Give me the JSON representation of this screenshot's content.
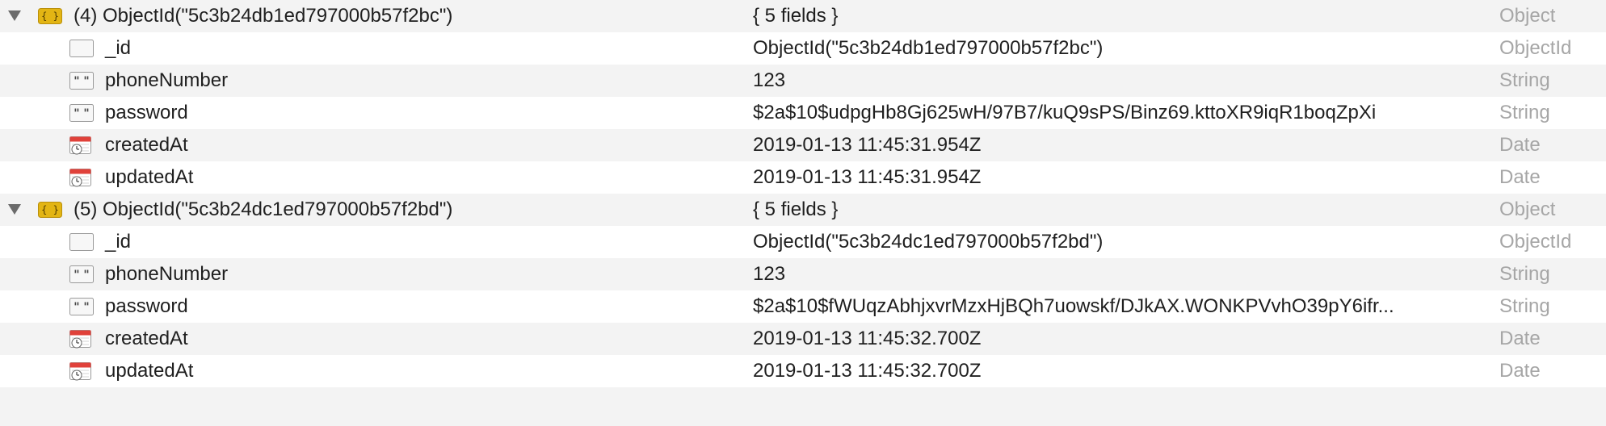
{
  "documents": [
    {
      "label": "(4) ObjectId(\"5c3b24db1ed797000b57f2bc\")",
      "summary": "{ 5 fields }",
      "type": "Object",
      "fields": [
        {
          "name": "_id",
          "value": "ObjectId(\"5c3b24db1ed797000b57f2bc\")",
          "type": "ObjectId",
          "icon": "objectid-icon"
        },
        {
          "name": "phoneNumber",
          "value": "123",
          "type": "String",
          "icon": "string-icon"
        },
        {
          "name": "password",
          "value": "$2a$10$udpgHb8Gj625wH/97B7/kuQ9sPS/Binz69.kttoXR9iqR1boqZpXi",
          "type": "String",
          "icon": "string-icon"
        },
        {
          "name": "createdAt",
          "value": "2019-01-13 11:45:31.954Z",
          "type": "Date",
          "icon": "date-icon"
        },
        {
          "name": "updatedAt",
          "value": "2019-01-13 11:45:31.954Z",
          "type": "Date",
          "icon": "date-icon"
        }
      ]
    },
    {
      "label": "(5) ObjectId(\"5c3b24dc1ed797000b57f2bd\")",
      "summary": "{ 5 fields }",
      "type": "Object",
      "fields": [
        {
          "name": "_id",
          "value": "ObjectId(\"5c3b24dc1ed797000b57f2bd\")",
          "type": "ObjectId",
          "icon": "objectid-icon"
        },
        {
          "name": "phoneNumber",
          "value": "123",
          "type": "String",
          "icon": "string-icon"
        },
        {
          "name": "password",
          "value": "$2a$10$fWUqzAbhjxvrMzxHjBQh7uowskf/DJkAX.WONKPVvhO39pY6ifr...",
          "type": "String",
          "icon": "string-icon"
        },
        {
          "name": "createdAt",
          "value": "2019-01-13 11:45:32.700Z",
          "type": "Date",
          "icon": "date-icon"
        },
        {
          "name": "updatedAt",
          "value": "2019-01-13 11:45:32.700Z",
          "type": "Date",
          "icon": "date-icon"
        }
      ]
    }
  ]
}
